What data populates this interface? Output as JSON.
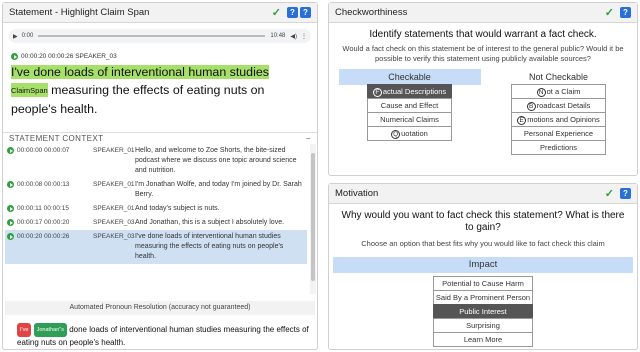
{
  "left": {
    "title": "Statement - Highlight Claim Span",
    "audio": {
      "current": "0:00",
      "total": "10:48"
    },
    "meta": "00:00:20 00:00:26 SPEAKER_03",
    "claim_highlight": "I've done loads of interventional human studies",
    "claim_tag": "ClaimSpan",
    "claim_rest": "measuring the effects of eating nuts on people's health.",
    "context_title": "STATEMENT CONTEXT",
    "collapse_symbol": "−",
    "rows": [
      {
        "start": "00:00:00",
        "end": "00:00:07",
        "speaker": "SPEAKER_01",
        "text": "Hello, and welcome to Zoe Shorts, the bite-sized podcast where we discuss one topic around science and nutrition.",
        "selected": false
      },
      {
        "start": "00:00:08",
        "end": "00:00:13",
        "speaker": "SPEAKER_01",
        "text": "I'm Jonathan Wolfe, and today I'm joined by Dr. Sarah Berry.",
        "selected": false
      },
      {
        "start": "00:00:11",
        "end": "00:00:15",
        "speaker": "SPEAKER_01",
        "text": "And today's subject is nuts.",
        "selected": false
      },
      {
        "start": "00:00:17",
        "end": "00:00:20",
        "speaker": "SPEAKER_03",
        "text": "And Jonathan, this is a subject I absolutely love.",
        "selected": false
      },
      {
        "start": "00:00:20",
        "end": "00:00:26",
        "speaker": "SPEAKER_03",
        "text": "I've done loads of interventional human studies measuring the effects of eating nuts on people's health.",
        "selected": true
      }
    ],
    "pronoun_label": "Automated Pronoun Resolution (accuracy not guaranteed)",
    "resolved": {
      "badge1": "I've",
      "badge2": "Jonathan\"s",
      "text": "done loads of interventional human studies measuring the effects of eating nuts on people's health."
    }
  },
  "checkworthiness": {
    "title": "Checkworthiness",
    "question": "Identify statements that would warrant a fact check.",
    "subtext": "Would a fact check on this statement be of interest to the general public? Would it be possible to verify this statement using publicly available sources?",
    "checkable_label": "Checkable",
    "not_checkable_label": "Not Checkable",
    "checkable_options": [
      {
        "letter": "F",
        "rest": "actual Descriptions",
        "selected": true
      },
      {
        "letter": "",
        "rest": "Cause and Effect",
        "selected": false
      },
      {
        "letter": "",
        "rest": "Numerical Claims",
        "selected": false
      },
      {
        "letter": "Q",
        "rest": "uotation",
        "selected": false
      }
    ],
    "not_checkable_options": [
      {
        "letter": "N",
        "rest": "ot a Claim",
        "selected": false
      },
      {
        "letter": "B",
        "rest": "roadcast Details",
        "selected": false
      },
      {
        "letter": "E",
        "rest": "motions and Opinions",
        "selected": false
      },
      {
        "letter": "",
        "rest": "Personal Experience",
        "selected": false
      },
      {
        "letter": "",
        "rest": "Predictions",
        "selected": false
      }
    ]
  },
  "motivation": {
    "title": "Motivation",
    "question": "Why would you want to fact check this statement? What is there to gain?",
    "subtext": "Choose an option that best fits why you would like to fact check this claim",
    "impact_label": "Impact",
    "options": [
      {
        "label": "Potential to Cause Harm",
        "selected": false
      },
      {
        "label": "Said By a Prominent Person",
        "selected": false
      },
      {
        "label": "Public Interest",
        "selected": true
      },
      {
        "label": "Surprising",
        "selected": false
      },
      {
        "label": "Learn More",
        "selected": false
      }
    ]
  },
  "ui": {
    "check": "✓",
    "help": "?"
  },
  "colors": {
    "highlight": "#a6e06a",
    "selected_row": "#cfe0f3",
    "header_active": "#c7dcf6",
    "help_button": "#2a6fd6",
    "check": "#2e9e3e"
  }
}
